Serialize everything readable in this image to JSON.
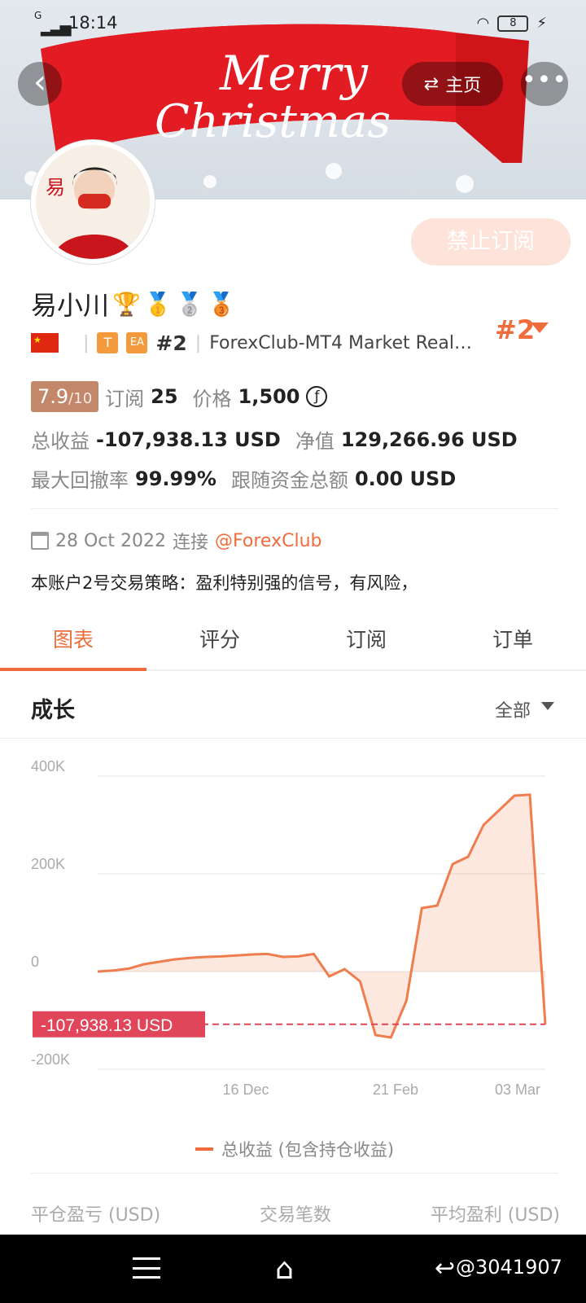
{
  "status": {
    "time": "18:14",
    "battery": "8"
  },
  "banner": {
    "text_line1": "Merry",
    "text_line2": "Christmas"
  },
  "header": {
    "home_label": "主页",
    "more_label": "•••",
    "back_label": "‹"
  },
  "profile": {
    "name": "易小川",
    "medals": [
      "🏆",
      "🥇",
      "🥈",
      "🥉"
    ],
    "unsubscribe_label": "禁止订阅",
    "tag_t": "T",
    "tag_ea": "EA",
    "rank_small": "#2",
    "server": "ForexClub-MT4 Market Real…",
    "rank_big": "#2"
  },
  "stats": {
    "score": "7.9",
    "score_total": "/10",
    "subscribe_label": "订阅",
    "subscribe_count": "25",
    "price_label": "价格",
    "price_value": "1,500",
    "price_symbol": "ƒ",
    "total_profit_label": "总收益",
    "total_profit_value": "-107,938.13 USD",
    "equity_label": "净值",
    "equity_value": "129,266.96 USD",
    "drawdown_label": "最大回撤率",
    "drawdown_value": "99.99%",
    "follow_label": "跟随资金总额",
    "follow_value": "0.00 USD"
  },
  "connect": {
    "date": "28 Oct 2022",
    "connect_label": "连接",
    "link": "@ForexClub"
  },
  "description": "本账户2号交易策略：盈利特别强的信号，有风险，",
  "tabs": [
    "图表",
    "评分",
    "订阅",
    "订单"
  ],
  "growth": {
    "title": "成长",
    "filter": "全部"
  },
  "chart_data": {
    "type": "area",
    "ylabels": [
      "400K",
      "200K",
      "0",
      "-200K"
    ],
    "xlabels": [
      "16 Dec",
      "21 Feb",
      "03 Mar"
    ],
    "ylim": [
      -200000,
      400000
    ],
    "current_value_label": "-107,938.13 USD",
    "series": [
      {
        "name": "总收益 (包含持仓收益)",
        "values": [
          0,
          2000,
          6000,
          15000,
          20000,
          25000,
          28000,
          30000,
          31000,
          33000,
          35000,
          36000,
          30000,
          31000,
          36000,
          -10000,
          5000,
          -20000,
          -130000,
          -135000,
          -60000,
          130000,
          135000,
          220000,
          235000,
          300000,
          330000,
          360000,
          362000,
          -107938
        ]
      }
    ]
  },
  "bottom_labels": [
    "平仓盈亏 (USD)",
    "交易笔数",
    "平均盈利 (USD)"
  ],
  "nav": {
    "watermark": "@3041907"
  }
}
